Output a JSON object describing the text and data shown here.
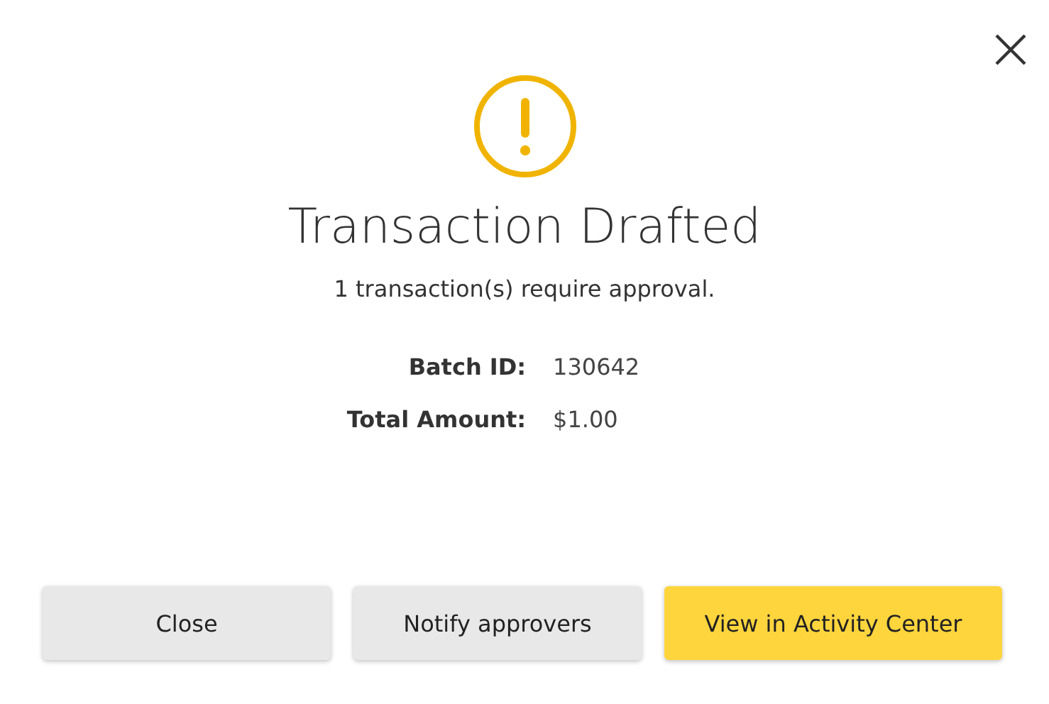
{
  "dialog": {
    "title": "Transaction Drafted",
    "message": "1 transaction(s) require approval.",
    "details": [
      {
        "label": "Batch ID:",
        "value": "130642"
      },
      {
        "label": "Total Amount:",
        "value": "$1.00"
      }
    ],
    "buttons": [
      {
        "label": "Close",
        "kind": "secondary"
      },
      {
        "label": "Notify approvers",
        "kind": "secondary"
      },
      {
        "label": "View in Activity Center",
        "kind": "primary"
      }
    ]
  }
}
